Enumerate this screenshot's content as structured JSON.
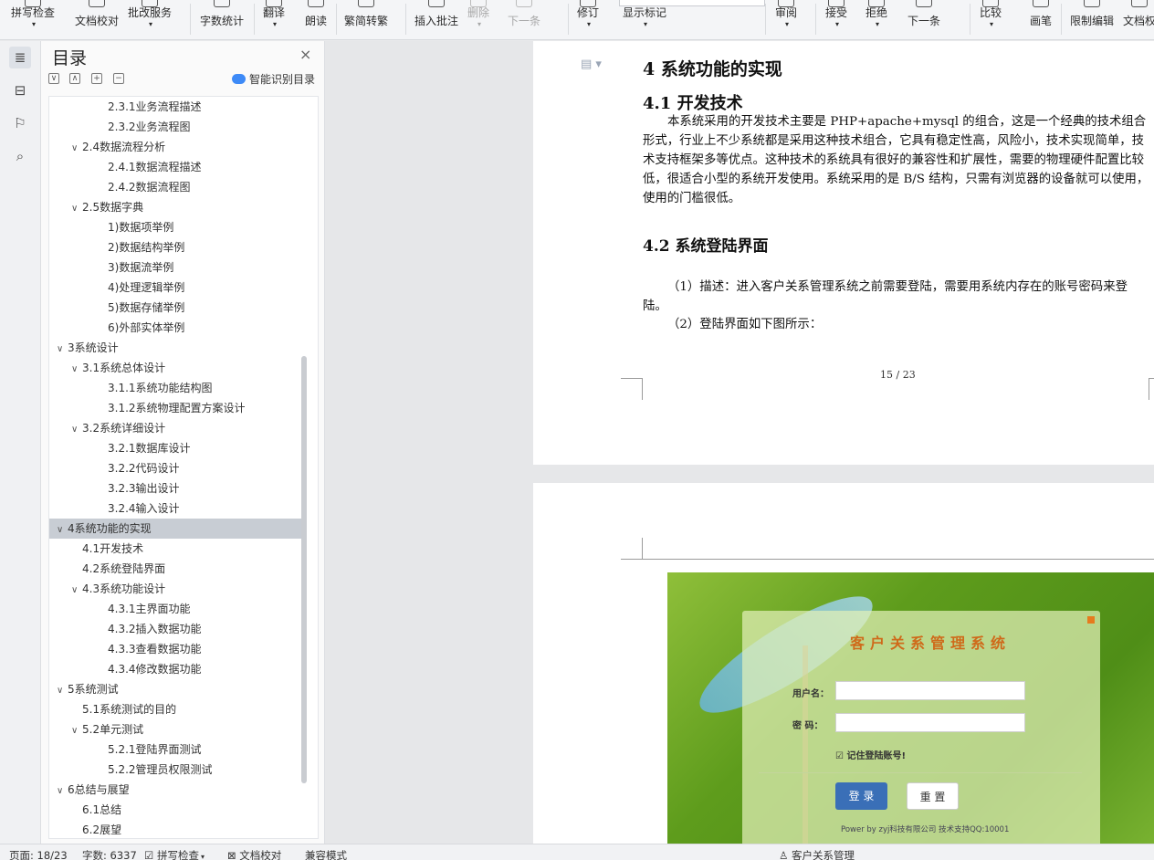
{
  "ribbon": {
    "buttons": [
      {
        "label": "拼写检查",
        "caret": "▾"
      },
      {
        "label": "文档校对"
      },
      {
        "label": "批改服务",
        "caret": "▾"
      },
      {
        "label": "字数统计"
      },
      {
        "label": "翻译",
        "caret": "▾"
      },
      {
        "label": "朗读"
      },
      {
        "label": "繁简转繁"
      },
      {
        "label": "插入批注"
      },
      {
        "label": "删除",
        "caret": "▾"
      },
      {
        "label": "下一条"
      },
      {
        "label": "修订",
        "caret": "▾"
      },
      {
        "label": "显示标记",
        "caret": "▾"
      },
      {
        "label": "审阅",
        "caret": "▾"
      },
      {
        "label": "接受",
        "caret": "▾"
      },
      {
        "label": "拒绝",
        "caret": "▾"
      },
      {
        "label": "下一条"
      },
      {
        "label": "比较",
        "caret": "▾"
      },
      {
        "label": "画笔"
      },
      {
        "label": "限制编辑"
      },
      {
        "label": "文档权"
      }
    ]
  },
  "toc": {
    "title": "目录",
    "close": "×",
    "smart_label": "智能识别目录",
    "items": [
      {
        "text": "2.3.1业务流程描述",
        "level": 3,
        "expand": ""
      },
      {
        "text": "2.3.2业务流程图",
        "level": 3,
        "expand": ""
      },
      {
        "text": "2.4数据流程分析",
        "level": 2,
        "expand": "∨"
      },
      {
        "text": "2.4.1数据流程描述",
        "level": 3,
        "expand": ""
      },
      {
        "text": "2.4.2数据流程图",
        "level": 3,
        "expand": ""
      },
      {
        "text": "2.5数据字典",
        "level": 2,
        "expand": "∨"
      },
      {
        "text": "1)数据项举例",
        "level": 3,
        "expand": ""
      },
      {
        "text": "2)数据结构举例",
        "level": 3,
        "expand": ""
      },
      {
        "text": "3)数据流举例",
        "level": 3,
        "expand": ""
      },
      {
        "text": "4)处理逻辑举例",
        "level": 3,
        "expand": ""
      },
      {
        "text": "5)数据存储举例",
        "level": 3,
        "expand": ""
      },
      {
        "text": "6)外部实体举例",
        "level": 3,
        "expand": ""
      },
      {
        "text": "3系统设计",
        "level": 1,
        "expand": "∨"
      },
      {
        "text": "3.1系统总体设计",
        "level": 2,
        "expand": "∨"
      },
      {
        "text": "3.1.1系统功能结构图",
        "level": 3,
        "expand": ""
      },
      {
        "text": "3.1.2系统物理配置方案设计",
        "level": 3,
        "expand": ""
      },
      {
        "text": "3.2系统详细设计",
        "level": 2,
        "expand": "∨"
      },
      {
        "text": "3.2.1数据库设计",
        "level": 3,
        "expand": ""
      },
      {
        "text": "3.2.2代码设计",
        "level": 3,
        "expand": ""
      },
      {
        "text": "3.2.3输出设计",
        "level": 3,
        "expand": ""
      },
      {
        "text": "3.2.4输入设计",
        "level": 3,
        "expand": ""
      },
      {
        "text": "4系统功能的实现",
        "level": 1,
        "expand": "∨",
        "selected": true
      },
      {
        "text": "4.1开发技术",
        "level": 2,
        "expand": ""
      },
      {
        "text": "4.2系统登陆界面",
        "level": 2,
        "expand": ""
      },
      {
        "text": "4.3系统功能设计",
        "level": 2,
        "expand": "∨"
      },
      {
        "text": "4.3.1主界面功能",
        "level": 3,
        "expand": ""
      },
      {
        "text": "4.3.2插入数据功能",
        "level": 3,
        "expand": ""
      },
      {
        "text": "4.3.3查看数据功能",
        "level": 3,
        "expand": ""
      },
      {
        "text": "4.3.4修改数据功能",
        "level": 3,
        "expand": ""
      },
      {
        "text": "5系统测试",
        "level": 1,
        "expand": "∨"
      },
      {
        "text": "5.1系统测试的目的",
        "level": 2,
        "expand": ""
      },
      {
        "text": "5.2单元测试",
        "level": 2,
        "expand": "∨"
      },
      {
        "text": "5.2.1登陆界面测试",
        "level": 3,
        "expand": ""
      },
      {
        "text": "5.2.2管理员权限测试",
        "level": 3,
        "expand": ""
      },
      {
        "text": "6总结与展望",
        "level": 1,
        "expand": "∨"
      },
      {
        "text": "6.1总结",
        "level": 2,
        "expand": ""
      },
      {
        "text": "6.2展望",
        "level": 2,
        "expand": ""
      }
    ]
  },
  "document": {
    "heading1": "4   系统功能的实现",
    "heading2a": "4.1 开发技术",
    "para1": "本系统采用的开发技术主要是 PHP+apache+mysql 的组合，这是一个经典的技术组合形式，行业上不少系统都是采用这种技术组合，它具有稳定性高，风险小，技术实现简单，技术支持框架多等优点。这种技术的系统具有很好的兼容性和扩展性，需要的物理硬件配置比较低，很适合小型的系统开发使用。系统采用的是 B/S 结构，只需有浏览器的设备就可以使用，使用的门槛很低。",
    "heading2b": "4.2 系统登陆界面",
    "para2": "（1）描述：进入客户关系管理系统之前需要登陆，需要用系统内存在的账号密码来登陆。",
    "para3": "（2）登陆界面如下图所示：",
    "page_number": "15 / 23"
  },
  "login_screenshot": {
    "title": "客户关系管理系统",
    "username_label": "用户名：",
    "password_label": "密  码：",
    "remember_label": "记住登陆账号!",
    "login_button": "登 录",
    "reset_button": "重 置",
    "footer": "Power by zyj科技有限公司 技术支持QQ:10001"
  },
  "status_bar": {
    "page": "页面: 18/23",
    "words": "字数: 6337",
    "spellcheck": "拼写检查",
    "proofread": "文档校对",
    "compat": "兼容模式",
    "doc_name": "客户关系管理"
  },
  "colors": {
    "selection": "#c8cdd4",
    "login_button": "#3a6fb7",
    "title_orange": "#cf6a1a"
  }
}
